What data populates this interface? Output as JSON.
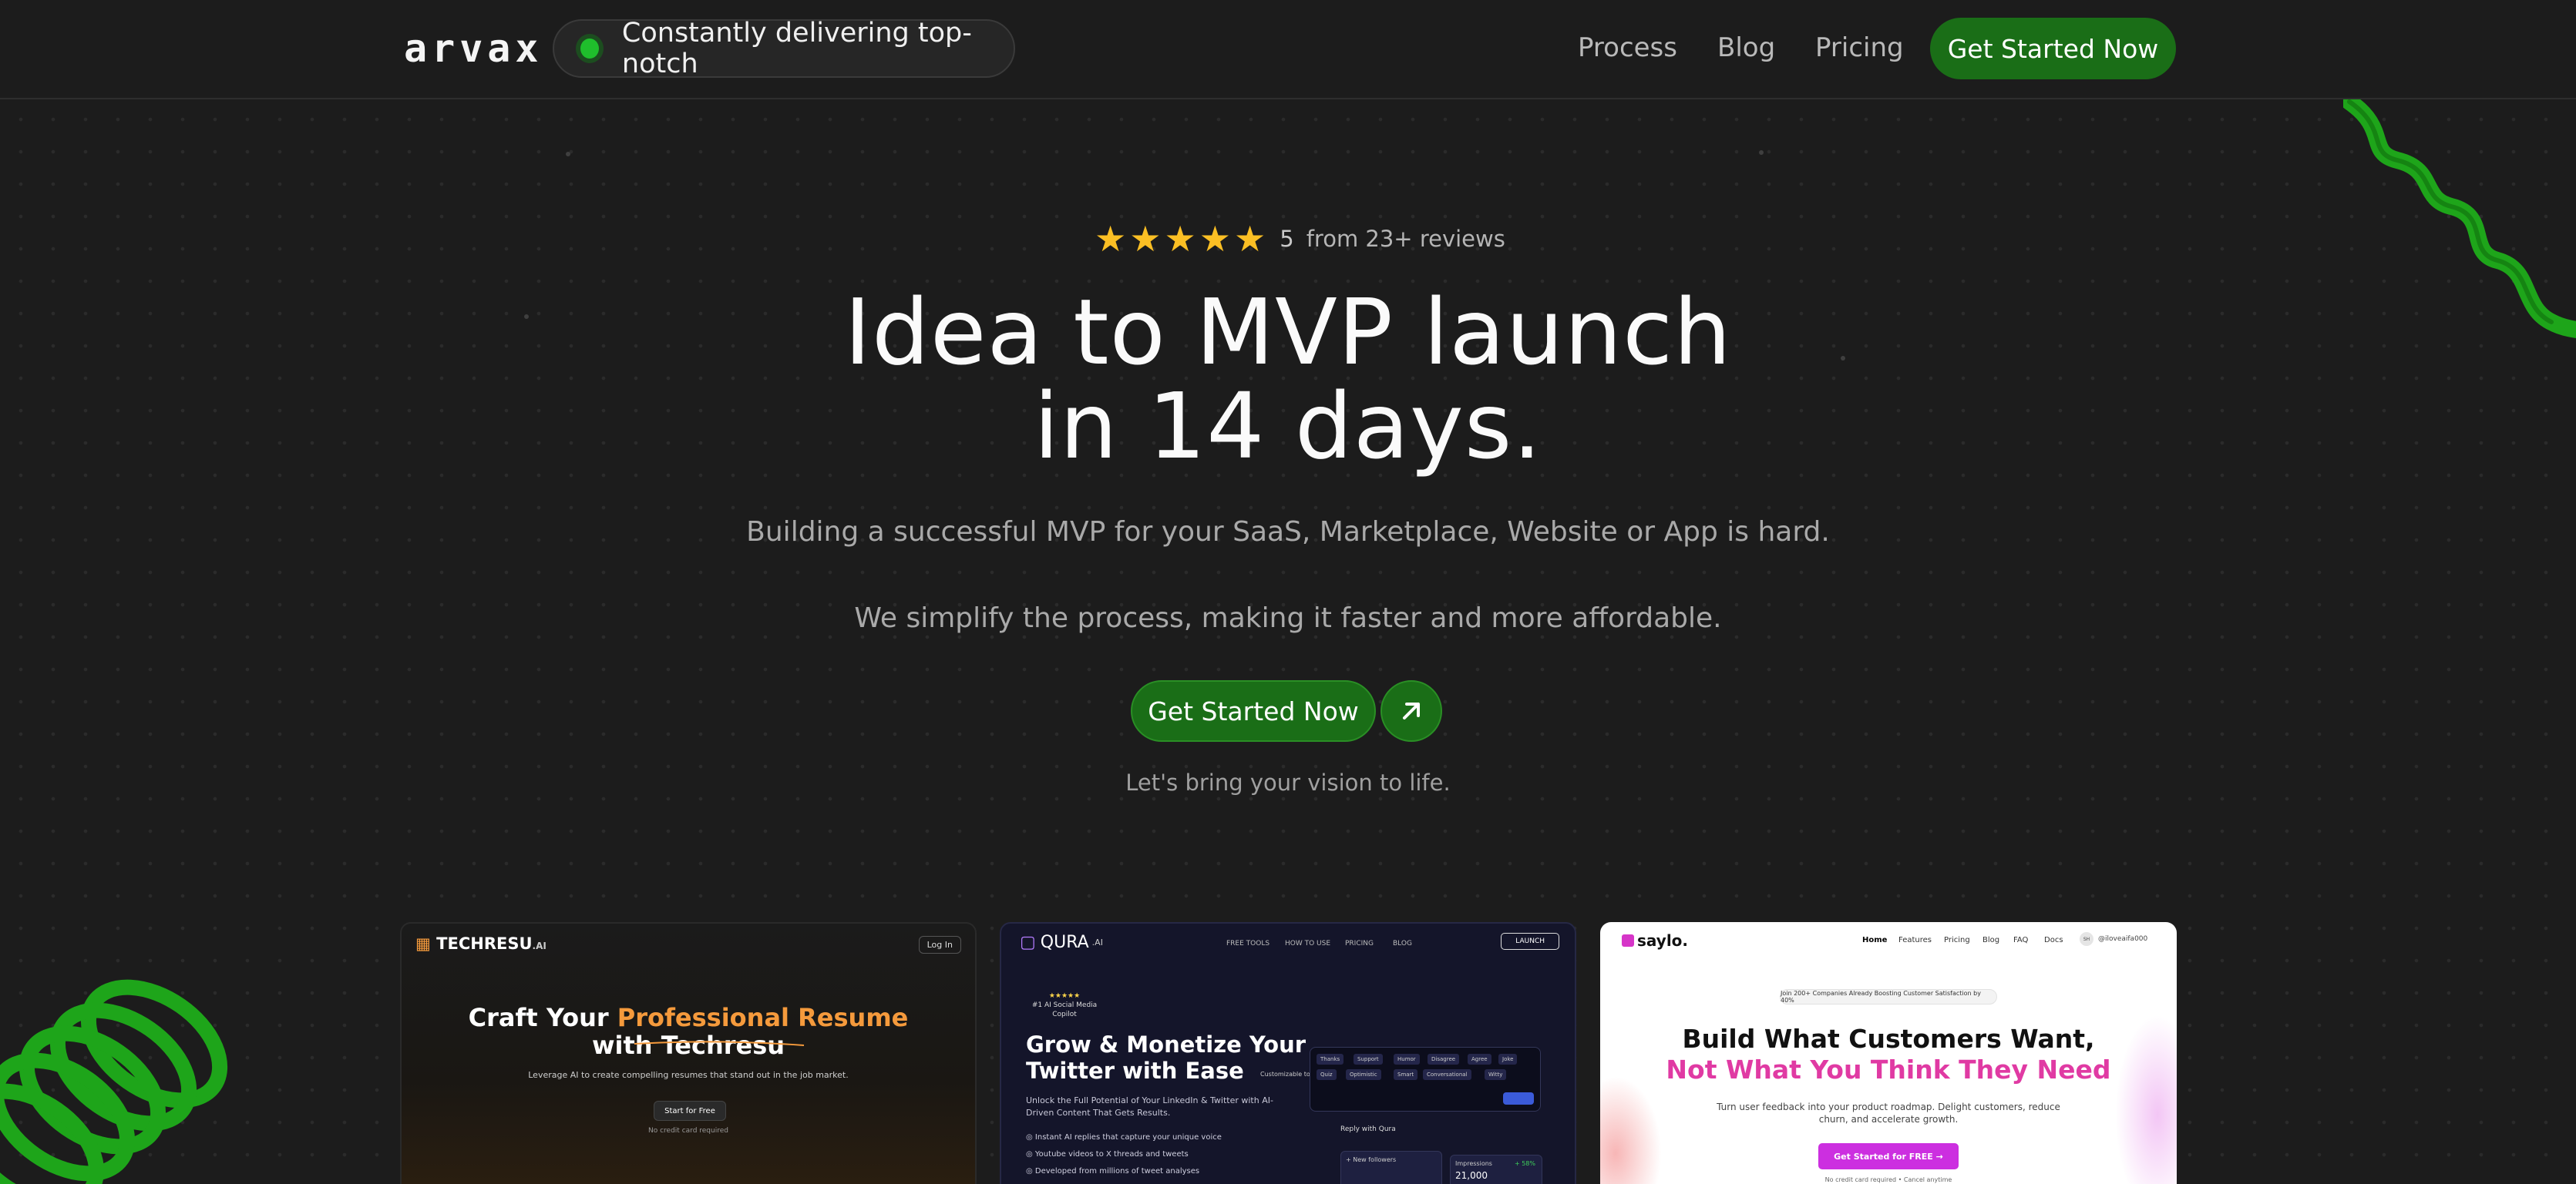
{
  "nav": {
    "logo": "arvax",
    "status_text": "Constantly delivering top-notch",
    "links": [
      "Process",
      "Blog",
      "Pricing"
    ],
    "cta_label": "Get Started Now"
  },
  "hero": {
    "rating_score": "5",
    "rating_text": "from 23+ reviews",
    "stars": 5,
    "title_line1": "Idea to MVP launch",
    "title_line2": "in 14 days.",
    "subtitle1": "Building a successful MVP for your SaaS, Marketplace, Website or App is hard.",
    "subtitle2": "We simplify the process, making it faster and more affordable.",
    "cta_label": "Get Started Now",
    "tagline": "Let's bring your vision to life."
  },
  "portfolio": {
    "techresu": {
      "logo": "TECHRESU",
      "logo_suffix": ".AI",
      "login": "Log In",
      "headline_pre": "Craft Your ",
      "headline_highlight": "Professional Resume",
      "headline_line2": "with Techresu",
      "description": "Leverage AI to create compelling resumes that stand out in the job market.",
      "button": "Start for Free",
      "note": "No credit card required"
    },
    "qura": {
      "logo": "QURA",
      "logo_suffix": ".AI",
      "nav": [
        "FREE TOOLS",
        "HOW TO USE",
        "PRICING",
        "BLOG"
      ],
      "launch": "LAUNCH",
      "badge": "#1 AI Social Media Copilot",
      "headline_line1": "Grow & Monetize Your",
      "headline_line2": "Twitter with Ease",
      "description": "Unlock the Full Potential of Your LinkedIn & Twitter with AI-Driven Content That Gets Results.",
      "features": [
        "Instant AI replies that capture your unique voice",
        "Youtube videos to X threads and tweets",
        "Developed from millions of tweet analyses"
      ],
      "chips": [
        "Thanks",
        "Support",
        "Humor",
        "Disagree",
        "Agree",
        "Joke",
        "Quiz",
        "Optimistic",
        "Smart",
        "Conversational",
        "Witty"
      ],
      "customizable": "Customizable tones",
      "reply": "Reply with Qura",
      "followers_label": "+ New followers",
      "impressions_label": "Impressions",
      "impressions_value": "21,000",
      "impressions_delta": "+ 58%"
    },
    "saylo": {
      "logo": "saylo.",
      "nav": [
        "Home",
        "Features",
        "Pricing",
        "Blog",
        "FAQ",
        "Docs"
      ],
      "user": "@iloveaifa000",
      "avatar": "SH",
      "pill": "Join 200+ Companies Already Boosting Customer Satisfaction by 40%",
      "headline_line1": "Build What Customers Want,",
      "headline_line2": "Not What You Think They Need",
      "description": "Turn user feedback into your product roadmap. Delight customers, reduce churn, and accelerate growth.",
      "button": "Get Started for FREE →",
      "note": "No credit card required • Cancel anytime"
    }
  },
  "colors": {
    "background": "#1c1c1c",
    "accent_green": "#1a6e17",
    "status_green": "#1fbf2c",
    "star_yellow": "#fbbf24",
    "techresu_orange": "#f59a3c",
    "saylo_pink": "#e03aa3",
    "saylo_button": "#cc2fe0"
  },
  "icons": {
    "status": "green-status-dot-icon",
    "star": "star-icon",
    "cta": "arrow-up-right-icon"
  }
}
